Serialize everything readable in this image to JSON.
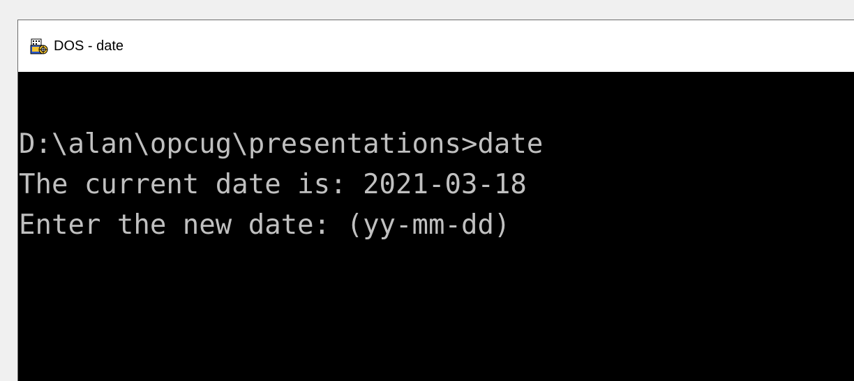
{
  "window": {
    "title": "DOS - date",
    "icon": "ms-dos-icon"
  },
  "console": {
    "lines": [
      "D:\\alan\\opcug\\presentations>date",
      "The current date is: 2021-03-18",
      "Enter the new date: (yy-mm-dd)"
    ],
    "text_color": "#c0c0c0",
    "background_color": "#000000"
  }
}
